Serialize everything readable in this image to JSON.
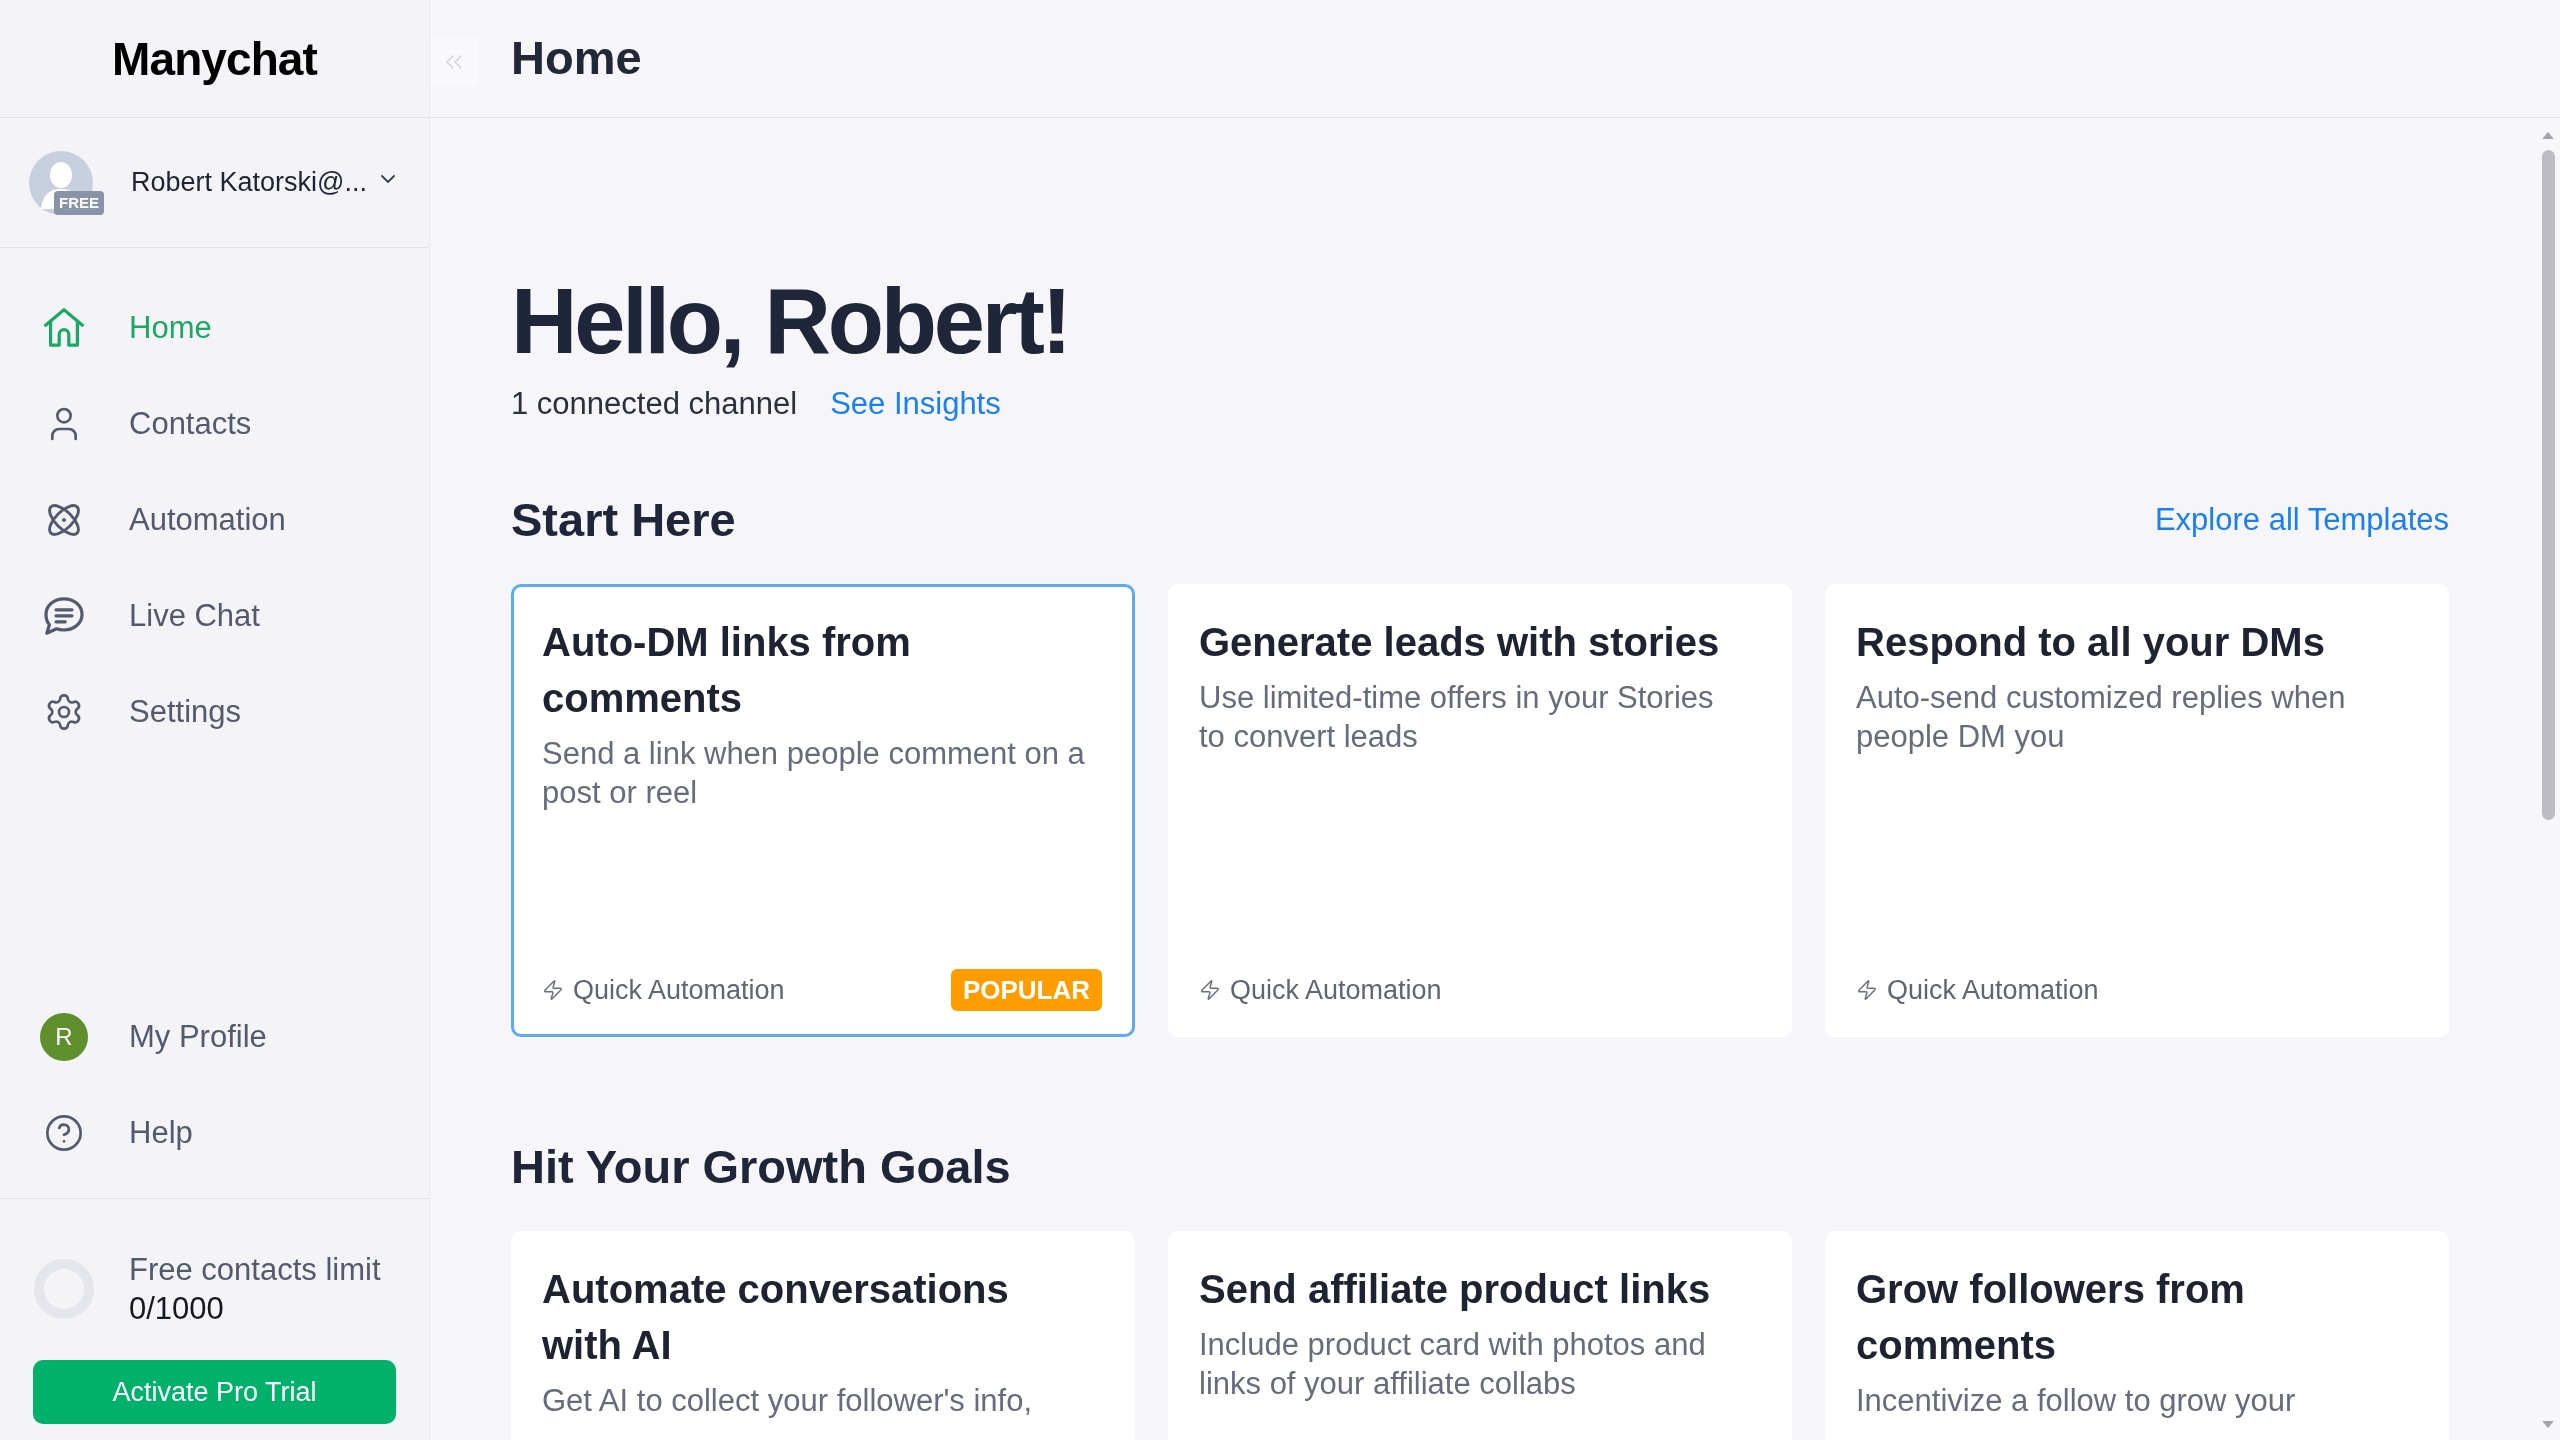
{
  "sidebar": {
    "logo": "Manychat",
    "account": {
      "name": "Robert Katorski@...",
      "plan_badge": "FREE"
    },
    "nav_items": [
      {
        "label": "Home",
        "selected": true
      },
      {
        "label": "Contacts",
        "selected": false
      },
      {
        "label": "Automation",
        "selected": false
      },
      {
        "label": "Live Chat",
        "selected": false
      },
      {
        "label": "Settings",
        "selected": false
      }
    ],
    "bottom_items": [
      {
        "kind": "avatar",
        "label": "My Profile",
        "initial": "R",
        "selected": false
      },
      {
        "kind": "icon",
        "label": "Help",
        "selected": false
      }
    ],
    "contacts_limit": {
      "label": "Free contacts limit",
      "reading": "0/1000"
    },
    "upgrade_button": "Activate Pro Trial"
  },
  "header": {
    "title": "Home"
  },
  "greeting": {
    "title": "Hello, Robert!",
    "channels": "1 connected channel",
    "insights_link": "See Insights"
  },
  "sections": [
    {
      "title": "Start Here",
      "link": "Explore all Templates",
      "cards": [
        {
          "title": "Auto-DM links from comments",
          "description": "Send a link when people comment on a post or reel",
          "tag": "Quick Automation",
          "badge": "POPULAR",
          "highlighted": true
        },
        {
          "title": "Generate leads with stories",
          "description": "Use limited-time offers in your Stories to convert leads",
          "tag": "Quick Automation",
          "highlighted": false
        },
        {
          "title": "Respond to all your DMs",
          "description": "Auto-send customized replies when people DM you",
          "tag": "Quick Automation",
          "highlighted": false
        }
      ]
    },
    {
      "title": "Hit Your Growth Goals",
      "cards": [
        {
          "title": "Automate conversations with AI",
          "description": "Get AI to collect your follower's info,",
          "highlighted": false
        },
        {
          "title": "Send affiliate product links",
          "description": "Include product card with photos and links of your affiliate collabs",
          "highlighted": false
        },
        {
          "title": "Grow followers from comments",
          "description": "Incentivize a follow to grow your",
          "highlighted": false
        }
      ]
    }
  ]
}
